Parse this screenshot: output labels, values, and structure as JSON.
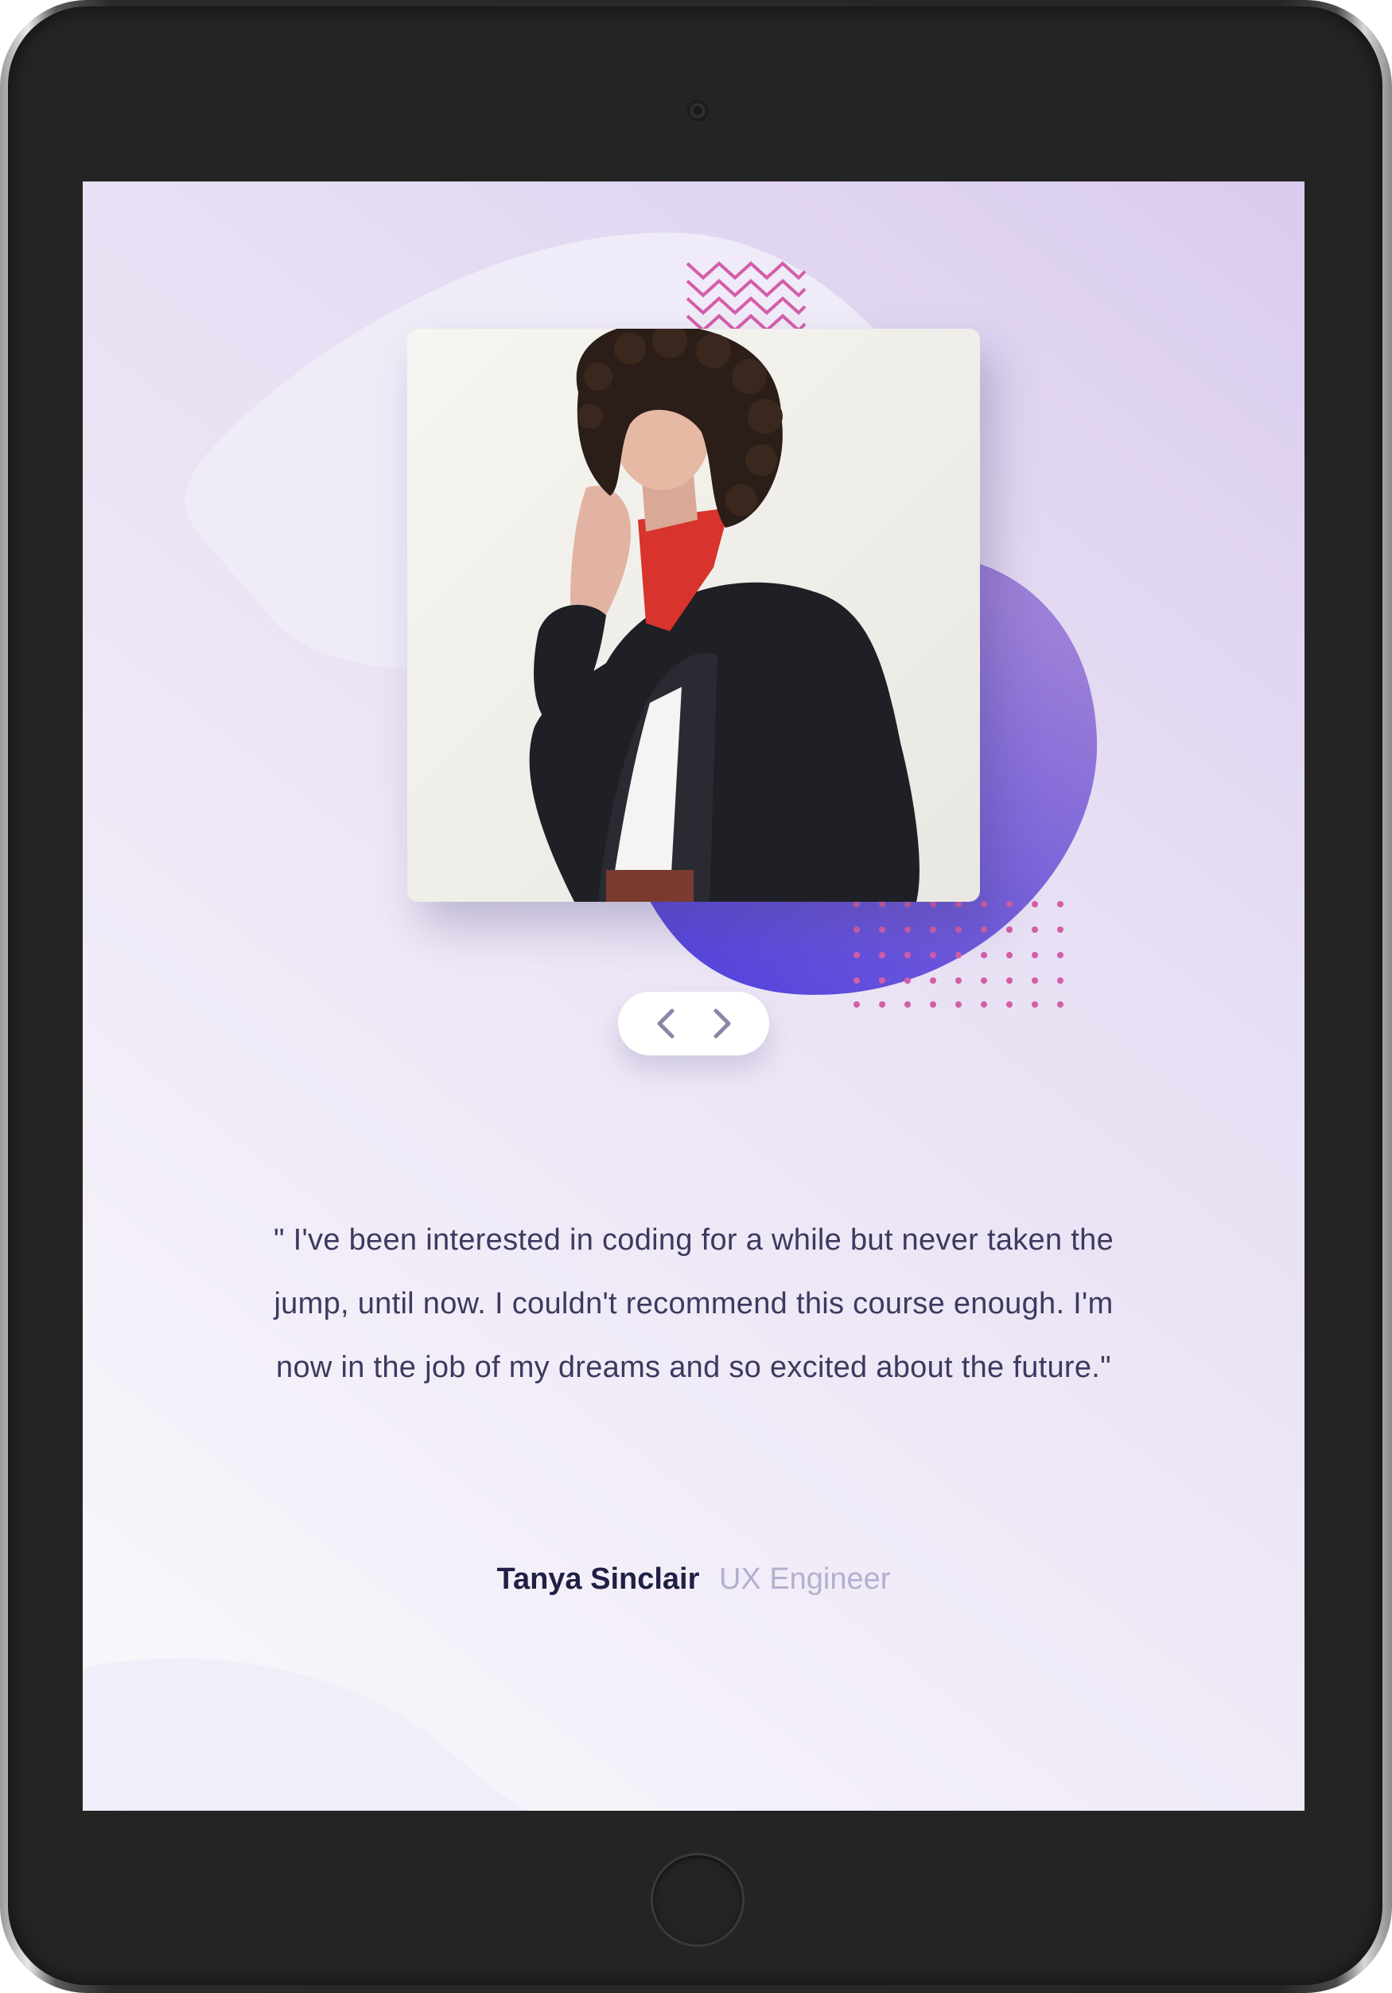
{
  "testimonial": {
    "quote": "\" I've been interested in coding for a while but never taken the jump, until now. I couldn't recommend this course enough. I'm now in the job of my dreams and so excited about the future.\"",
    "author_name": "Tanya Sinclair",
    "author_role": "UX Engineer"
  },
  "navigation": {
    "previous_icon": "chevron-left-icon",
    "next_icon": "chevron-right-icon"
  },
  "colors": {
    "accent_purple": "#5a4de0",
    "pattern_pink": "#d45ea7",
    "quote_text": "#3c3a5f",
    "name_text": "#202046",
    "role_text": "#b3b0cf"
  }
}
